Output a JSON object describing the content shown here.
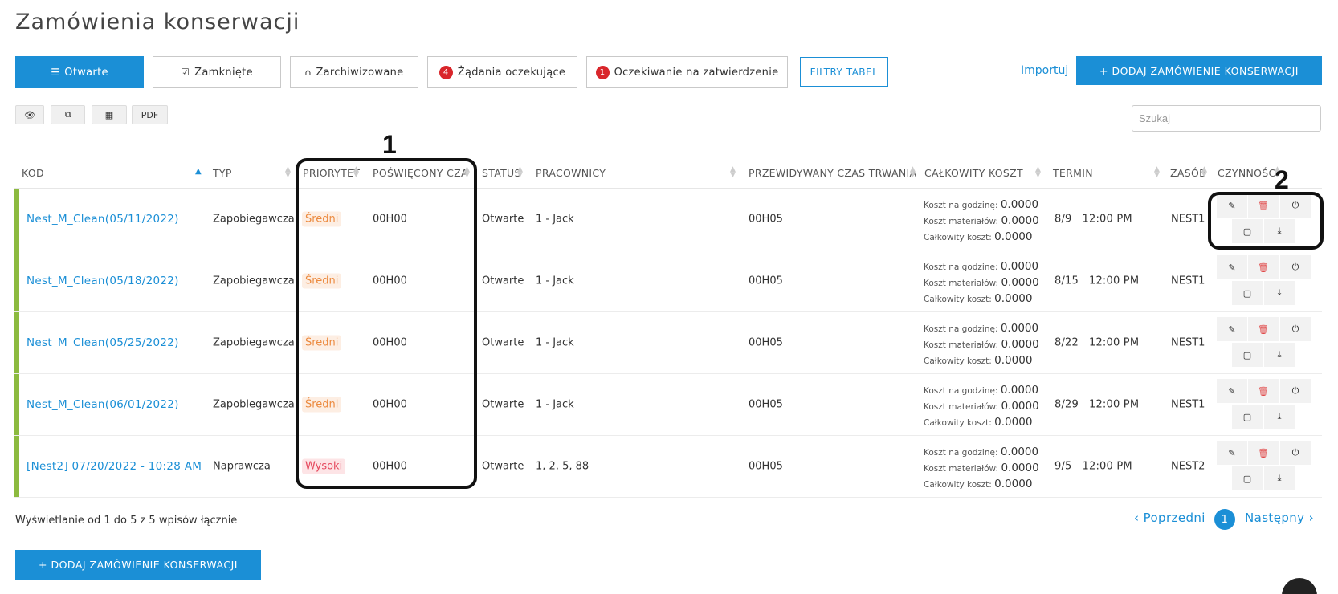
{
  "page_title": "Zamówienia konserwacji",
  "tabs": [
    {
      "label": "Otwarte",
      "icon": "list-icon",
      "active": true
    },
    {
      "label": "Zamknięte",
      "icon": "check-square-icon",
      "active": false
    },
    {
      "label": "Zarchiwizowane",
      "icon": "archive-icon",
      "active": false
    },
    {
      "label": "Żądania oczekujące",
      "badge": "4",
      "active": false
    },
    {
      "label": "Oczekiwanie na zatwierdzenie",
      "badge": "1",
      "active": false
    }
  ],
  "filters_label": "FILTRY TABEL",
  "import_label": "Importuj",
  "add_label": "+ DODAJ ZAMÓWIENIE KONSERWACJI",
  "toolbar": {
    "pdf_label": "PDF"
  },
  "search": {
    "placeholder": "Szukaj",
    "value": ""
  },
  "columns": [
    "KOD",
    "TYP",
    "PRIORYTET",
    "POŚWIĘCONY CZAS",
    "STATUS",
    "PRACOWNICY",
    "PRZEWIDYWANY CZAS TRWANIA",
    "CAŁKOWITY KOSZT",
    "TERMIN",
    "ZASÓB",
    "CZYNNOŚCI"
  ],
  "cost_labels": {
    "hourly": "Koszt na godzinę:",
    "materials": "Koszt materiałów:",
    "total": "Całkowity koszt:"
  },
  "rows": [
    {
      "code": "Nest_M_Clean(05/11/2022)",
      "type": "Zapobiegawcza",
      "priority": "Średni",
      "priority_level": "medium",
      "time_spent": "00H00",
      "status": "Otwarte",
      "workers": "1 - Jack",
      "duration": "00H05",
      "hourly": "0.0000",
      "materials": "0.0000",
      "total": "0.0000",
      "due": "8/9   12:00 PM",
      "asset": "NEST1"
    },
    {
      "code": "Nest_M_Clean(05/18/2022)",
      "type": "Zapobiegawcza",
      "priority": "Średni",
      "priority_level": "medium",
      "time_spent": "00H00",
      "status": "Otwarte",
      "workers": "1 - Jack",
      "duration": "00H05",
      "hourly": "0.0000",
      "materials": "0.0000",
      "total": "0.0000",
      "due": "8/15   12:00 PM",
      "asset": "NEST1"
    },
    {
      "code": "Nest_M_Clean(05/25/2022)",
      "type": "Zapobiegawcza",
      "priority": "Średni",
      "priority_level": "medium",
      "time_spent": "00H00",
      "status": "Otwarte",
      "workers": "1 - Jack",
      "duration": "00H05",
      "hourly": "0.0000",
      "materials": "0.0000",
      "total": "0.0000",
      "due": "8/22   12:00 PM",
      "asset": "NEST1"
    },
    {
      "code": "Nest_M_Clean(06/01/2022)",
      "type": "Zapobiegawcza",
      "priority": "Średni",
      "priority_level": "medium",
      "time_spent": "00H00",
      "status": "Otwarte",
      "workers": "1 - Jack",
      "duration": "00H05",
      "hourly": "0.0000",
      "materials": "0.0000",
      "total": "0.0000",
      "due": "8/29   12:00 PM",
      "asset": "NEST1"
    },
    {
      "code": "[Nest2] 07/20/2022 - 10:28 AM",
      "type": "Naprawcza",
      "priority": "Wysoki",
      "priority_level": "high",
      "time_spent": "00H00",
      "status": "Otwarte",
      "workers": "1, 2, 5, 88",
      "duration": "00H05",
      "hourly": "0.0000",
      "materials": "0.0000",
      "total": "0.0000",
      "due": "9/5   12:00 PM",
      "asset": "NEST2"
    }
  ],
  "annotations": [
    "1",
    "2"
  ],
  "info_text": "Wyświetlanie od 1 do 5 z 5 wpisów łącznie",
  "pagination": {
    "prev": "‹ Poprzedni",
    "current": "1",
    "next": "Następny ›"
  },
  "colors": {
    "accent": "#1b8fd6",
    "row_bar": "#8cba3f",
    "medium": "#ec8a3f",
    "high": "#e5485d"
  }
}
